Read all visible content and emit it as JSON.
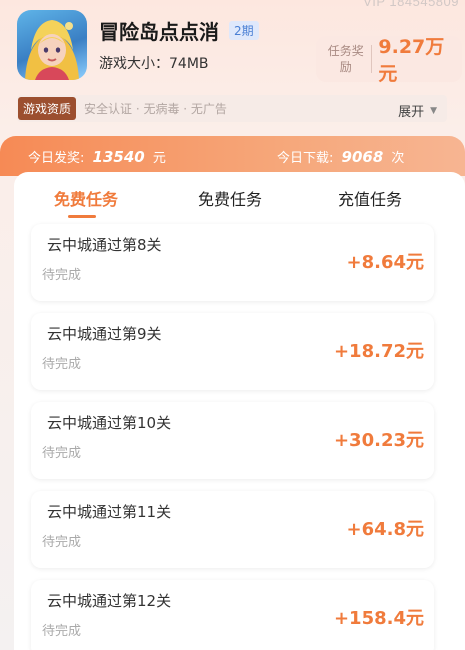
{
  "header": {
    "vip_text": "VIP 184545809",
    "app_title": "冒险岛点点消",
    "period_badge": "2期",
    "app_size": "游戏大小：74MB",
    "reward_label": "任务奖励",
    "reward_value": "9.27万元"
  },
  "qualification": {
    "tag": "游戏资质",
    "text": "安全认证 · 无病毒 · 无广告",
    "expand_label": "展开"
  },
  "stats": {
    "payout_label": "今日发奖:",
    "payout_value": "13540",
    "payout_unit": "元",
    "downloads_label": "今日下载:",
    "downloads_value": "9068",
    "downloads_unit": "次"
  },
  "tabs": [
    {
      "label": "免费任务",
      "active": true
    },
    {
      "label": "免费任务",
      "active": false
    },
    {
      "label": "充值任务",
      "active": false
    }
  ],
  "tasks": [
    {
      "title": "云中城通过第8关",
      "status": "待完成",
      "reward": "+8.64元"
    },
    {
      "title": "云中城通过第9关",
      "status": "待完成",
      "reward": "+18.72元"
    },
    {
      "title": "云中城通过第10关",
      "status": "待完成",
      "reward": "+30.23元"
    },
    {
      "title": "云中城通过第11关",
      "status": "待完成",
      "reward": "+64.8元"
    },
    {
      "title": "云中城通过第12关",
      "status": "待完成",
      "reward": "+158.4元"
    }
  ],
  "colors": {
    "accent": "#f07b3c",
    "qualification_tag": "#9c4f2f",
    "period_badge_text": "#4a7fd4"
  }
}
